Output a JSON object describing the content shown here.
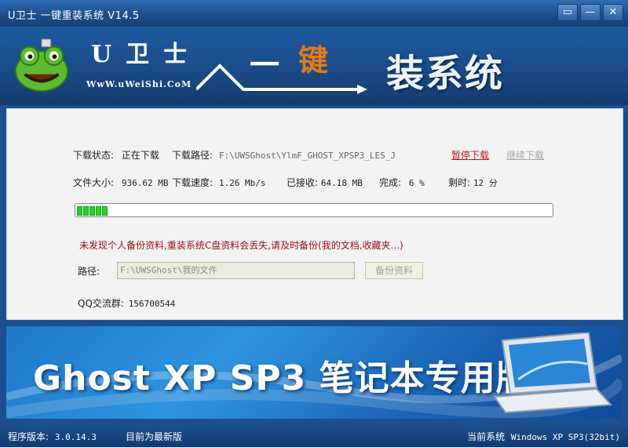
{
  "window": {
    "title": "U卫士 一键重装系统 V14.5",
    "buttons": {
      "feedback": "▭",
      "minimize": "—",
      "close": "✕"
    }
  },
  "banner": {
    "brand": "U卫士",
    "site": "WwW.uWeiShi.CoM",
    "slogan_part1": "一",
    "slogan_part2": "键",
    "slogan_part3": "装系统"
  },
  "download": {
    "status_label": "下载状态:",
    "status_value": "正在下载",
    "path_label": "下载路径:",
    "path_value": "F:\\UWSGhost\\YlmF_GHOST_XPSP3_LES_J",
    "pause_label": "暂停下载",
    "resume_label": "继续下载",
    "size_label": "文件大小:",
    "size_value": "936.62 MB",
    "speed_label": "下载速度:",
    "speed_value": "1.26 Mb/s",
    "received_label": "已接收:",
    "received_value": "64.18 MB",
    "complete_label": "完成:",
    "complete_value": "6 %",
    "remaining_label": "剩时:",
    "remaining_value": "12 分",
    "progress_fraction": 0.06
  },
  "backup": {
    "warning": "未发现个人备份资料,重装系统C盘资料会丢失,请及时备份(我的文档,收藏夹...)",
    "path_label": "路径:",
    "path_value": "F:\\UWSGhost\\我的文件",
    "button_label": "备份资料",
    "qq_label": "QQ交流群:",
    "qq_value": "156700544"
  },
  "ad": {
    "text": "Ghost XP SP3 笔记本专用版"
  },
  "status": {
    "version_label": "程序版本:",
    "version_value": "3.0.14.3",
    "latest": "目前为最新版",
    "current_system_label": "当前系统",
    "current_system_value": "Windows XP SP3(32bit)"
  },
  "colors": {
    "titlebar": "#1c4f8e",
    "progress_fill": "#2bd12b",
    "warning": "#a01010",
    "pause_link": "#c01818"
  }
}
